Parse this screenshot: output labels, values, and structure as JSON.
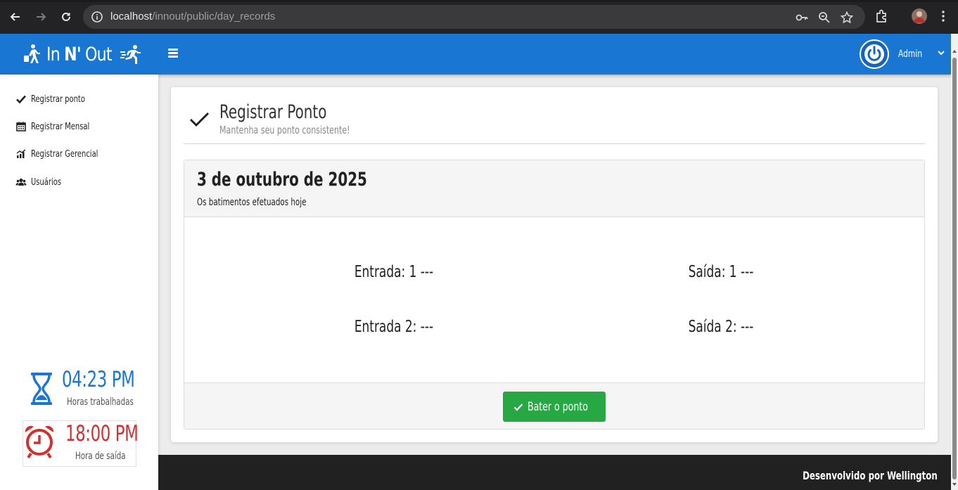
{
  "browser": {
    "url_host": "localhost",
    "url_path": "/innout/public/day_records"
  },
  "header": {
    "logo_text_in": "In",
    "logo_text_n": "N'",
    "logo_text_out": "Out",
    "user_name": "Admin",
    "brand_color": "#1976d2"
  },
  "sidebar": {
    "items": [
      {
        "label": "Registrar ponto",
        "icon": "check-icon"
      },
      {
        "label": "Registrar Mensal",
        "icon": "calendar-icon"
      },
      {
        "label": "Registrar Gerencial",
        "icon": "chart-icon"
      },
      {
        "label": "Usuários",
        "icon": "users-icon"
      }
    ],
    "worked": {
      "time": "04:23 PM",
      "label": "Horas trabalhadas",
      "icon": "hourglass-icon",
      "color": "#1976d2"
    },
    "exit": {
      "time": "18:00 PM",
      "label": "Hora de saída",
      "icon": "alarm-clock-icon",
      "color": "#d32f2f"
    }
  },
  "main": {
    "title": "Registrar Ponto",
    "subtitle": "Mantenha seu ponto consistente!",
    "date": "3 de outubro de 2025",
    "description": "Os batimentos efetuados hoje",
    "records": {
      "entrada1": "Entrada: 1 ---",
      "saida1": "Saída: 1 ---",
      "entrada2": "Entrada 2: ---",
      "saida2": "Saída 2: ---"
    },
    "punch_button": "Bater o ponto",
    "button_color": "#28a745"
  },
  "footer": {
    "text": "Desenvolvido por Wellington"
  }
}
